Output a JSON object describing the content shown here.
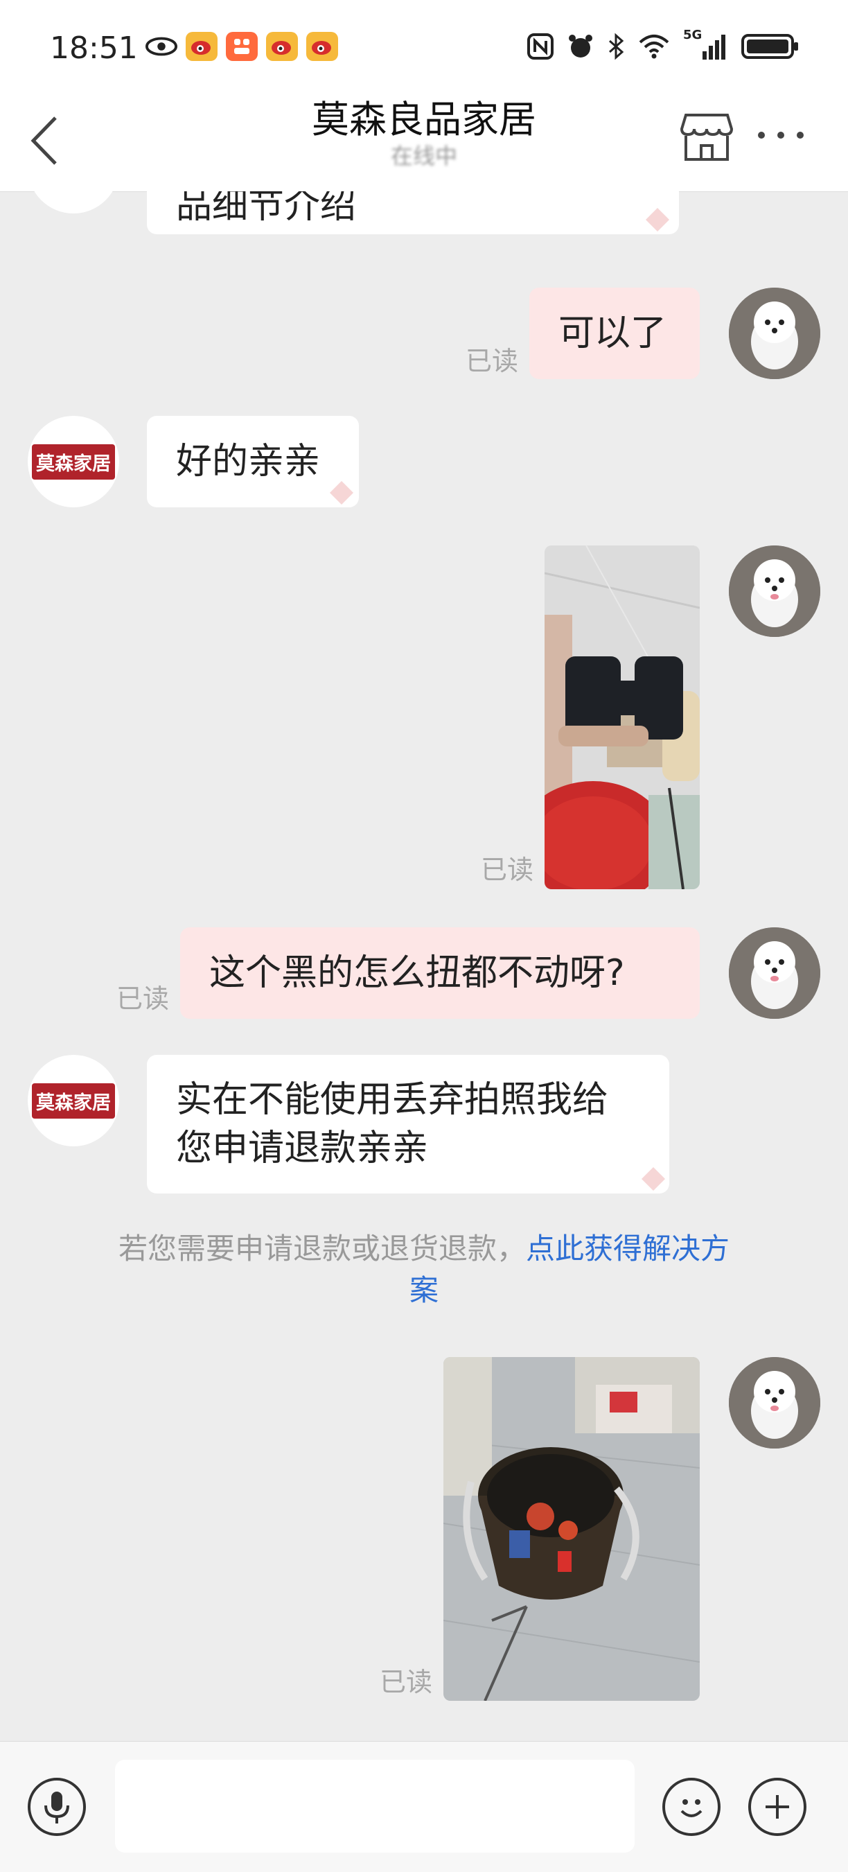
{
  "status_bar": {
    "time": "18:51",
    "network": "5G"
  },
  "header": {
    "title": "莫森良品家居",
    "subtitle": "在线中"
  },
  "shop": {
    "avatar_text": "莫森家居"
  },
  "messages": {
    "m1_text": "品细节介绍",
    "m2_text": "可以了",
    "m3_text": "好的亲亲",
    "m5_text": "这个黑的怎么扭都不动呀?",
    "m6_line1": "实在不能使用丢弃拍照我给",
    "m6_line2": "您申请退款亲亲",
    "read_label": "已读"
  },
  "notice": {
    "text": "若您需要申请退款或退货退款，",
    "link_text": "点此获得解决方",
    "link_text2": "案"
  },
  "input_bar": {
    "placeholder": ""
  },
  "colors": {
    "background": "#ededed",
    "sent_bubble": "#fde6e6",
    "received_bubble": "#ffffff",
    "link": "#2e6fd4",
    "shop_brand": "#b0232b"
  },
  "icons": [
    "back-arrow-icon",
    "store-icon",
    "more-icon",
    "microphone-icon",
    "emoji-icon",
    "plus-icon"
  ]
}
